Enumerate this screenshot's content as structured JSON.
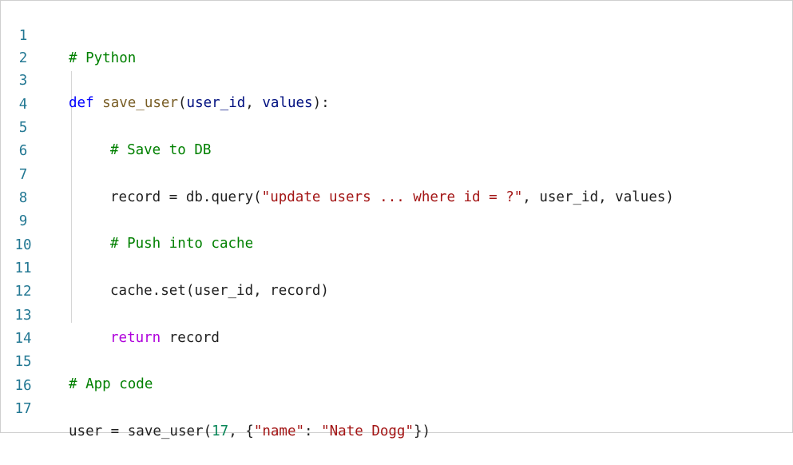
{
  "editor": {
    "language_comment": "# Python",
    "lines": [
      {
        "n": "1"
      },
      {
        "n": "2"
      },
      {
        "n": "3"
      },
      {
        "n": "4"
      },
      {
        "n": "5"
      },
      {
        "n": "6"
      },
      {
        "n": "7"
      },
      {
        "n": "8"
      },
      {
        "n": "9"
      },
      {
        "n": "10"
      },
      {
        "n": "11"
      },
      {
        "n": "12"
      },
      {
        "n": "13"
      },
      {
        "n": "14"
      },
      {
        "n": "15"
      },
      {
        "n": "16"
      },
      {
        "n": "17"
      }
    ],
    "tokens": {
      "l1_comment": "# Python",
      "l3_def": "def",
      "l3_space": " ",
      "l3_fn": "save_user",
      "l3_open": "(",
      "l3_p1": "user_id",
      "l3_comma": ", ",
      "l3_p2": "values",
      "l3_close": "):",
      "l5_comment": "# Save to DB",
      "l7_pre": "record = db.query(",
      "l7_str": "\"update users ... where id = ?\"",
      "l7_post": ", user_id, values)",
      "l9_comment": "# Push into cache",
      "l11_code": "cache.set(user_id, record)",
      "l13_kw": "return",
      "l13_rest": " record",
      "l15_comment": "# App code",
      "l17_pre": "user = save_user(",
      "l17_num": "17",
      "l17_mid1": ", {",
      "l17_key": "\"name\"",
      "l17_colon": ": ",
      "l17_val": "\"Nate Dogg\"",
      "l17_end": "})"
    }
  },
  "colors": {
    "line_number": "#237893",
    "comment": "#008000",
    "keyword_def": "#0000ff",
    "keyword_return": "#af00db",
    "function": "#795e26",
    "parameter": "#001080",
    "string": "#a31515",
    "number": "#098658"
  }
}
